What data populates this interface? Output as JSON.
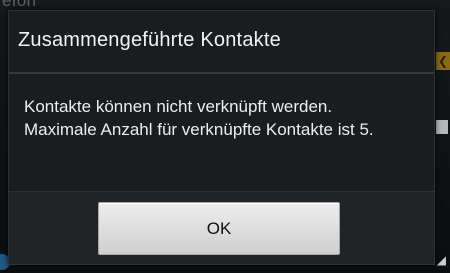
{
  "background": {
    "partial_label": "efon"
  },
  "dialog": {
    "title": "Zusammengeführte Kontakte",
    "message": "Kontakte können nicht verknüpft werden.\nMaximale Anzahl für verknüpfte Kontakte ist 5.",
    "ok_label": "OK"
  },
  "colors": {
    "dialog_background": "#1a1d20",
    "button_background": "#dcdcdc",
    "text": "#ededed"
  }
}
